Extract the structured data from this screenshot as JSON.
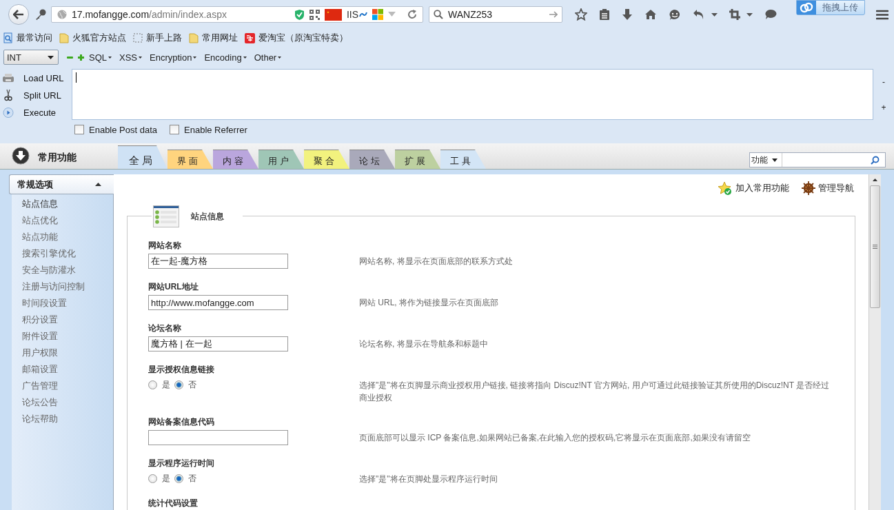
{
  "browser": {
    "url_host": "17.mofangge.com",
    "url_path": "/admin/index.aspx",
    "server_label": "IIS",
    "search_value": "WANZ253",
    "upload_button": "拖拽上传"
  },
  "bookmarks": [
    {
      "label": "最常访问",
      "kind": "history"
    },
    {
      "label": "火狐官方站点",
      "kind": "folder"
    },
    {
      "label": "新手上路",
      "kind": "dashed"
    },
    {
      "label": "常用网址",
      "kind": "folder"
    },
    {
      "label": "爱淘宝（原淘宝特卖）",
      "kind": "shop"
    }
  ],
  "hackbar": {
    "select": "INT",
    "menus": [
      "SQL",
      "XSS",
      "Encryption",
      "Encoding",
      "Other"
    ],
    "actions": [
      {
        "label": "Load URL",
        "kind": "load"
      },
      {
        "label": "Split URL",
        "kind": "split"
      },
      {
        "label": "Execute",
        "kind": "execute"
      }
    ],
    "side_controls": [
      "-",
      "+"
    ],
    "options": [
      {
        "label": "Enable Post data",
        "checked": false
      },
      {
        "label": "Enable Referrer",
        "checked": false
      }
    ]
  },
  "admin": {
    "quick_label": "常用功能",
    "tabs": [
      {
        "label": "全 局",
        "selected": true,
        "color": "#cfe2f5"
      },
      {
        "label": "界 面",
        "selected": false,
        "color": "#ffd47e"
      },
      {
        "label": "内 容",
        "selected": false,
        "color": "#baa6dd"
      },
      {
        "label": "用 户",
        "selected": false,
        "color": "#9fc6b6"
      },
      {
        "label": "聚 合",
        "selected": false,
        "color": "#f2f27e"
      },
      {
        "label": "论 坛",
        "selected": false,
        "color": "#a9a9ba"
      },
      {
        "label": "扩 展",
        "selected": false,
        "color": "#bdd0a0"
      },
      {
        "label": "工 具",
        "selected": false,
        "color": "#d3e5f6"
      }
    ],
    "search": {
      "scope": "功能"
    },
    "sidebar": {
      "header": "常规选项",
      "expanded": true,
      "items": [
        {
          "label": "站点信息",
          "selected": true
        },
        {
          "label": "站点优化",
          "selected": false
        },
        {
          "label": "站点功能",
          "selected": false
        },
        {
          "label": "搜索引擎优化",
          "selected": false
        },
        {
          "label": "安全与防灌水",
          "selected": false
        },
        {
          "label": "注册与访问控制",
          "selected": false
        },
        {
          "label": "时间段设置",
          "selected": false
        },
        {
          "label": "积分设置",
          "selected": false
        },
        {
          "label": "附件设置",
          "selected": false
        },
        {
          "label": "用户权限",
          "selected": false
        },
        {
          "label": "邮箱设置",
          "selected": false
        },
        {
          "label": "广告管理",
          "selected": false
        },
        {
          "label": "论坛公告",
          "selected": false
        },
        {
          "label": "论坛帮助",
          "selected": false
        }
      ]
    },
    "links": [
      {
        "label": "加入常用功能",
        "kind": "star"
      },
      {
        "label": "管理导航",
        "kind": "helm"
      }
    ],
    "section": {
      "title": "站点信息",
      "fields": [
        {
          "kind": "text",
          "label": "网站名称",
          "value": "在一起-魔方格",
          "description": "网站名称, 将显示在页面底部的联系方式处"
        },
        {
          "kind": "text",
          "label": "网站URL地址",
          "value": "http://www.mofangge.com",
          "description": "网站 URL, 将作为链接显示在页面底部"
        },
        {
          "kind": "text",
          "label": "论坛名称",
          "value": "魔方格 | 在一起",
          "description": "论坛名称, 将显示在导航条和标题中"
        },
        {
          "kind": "radio",
          "label": "显示授权信息链接",
          "options": [
            {
              "label": "是",
              "selected": false
            },
            {
              "label": "否",
              "selected": true
            }
          ],
          "description": "选择\"是\"将在页脚显示商业授权用户链接, 链接将指向 Discuz!NT 官方网站, 用户可通过此链接验证其所使用的Discuz!NT 是否经过商业授权"
        },
        {
          "kind": "text",
          "label": "网站备案信息代码",
          "description": "页面底部可以显示 ICP 备案信息,如果网站已备案,在此输入您的授权码,它将显示在页面底部,如果没有请留空"
        },
        {
          "kind": "radio",
          "label": "显示程序运行时间",
          "options": [
            {
              "label": "是",
              "selected": false
            },
            {
              "label": "否",
              "selected": true
            }
          ],
          "description": "选择\"是\"将在页脚处显示程序运行时间"
        },
        {
          "kind": "heading",
          "label": "统计代码设置"
        }
      ]
    }
  }
}
